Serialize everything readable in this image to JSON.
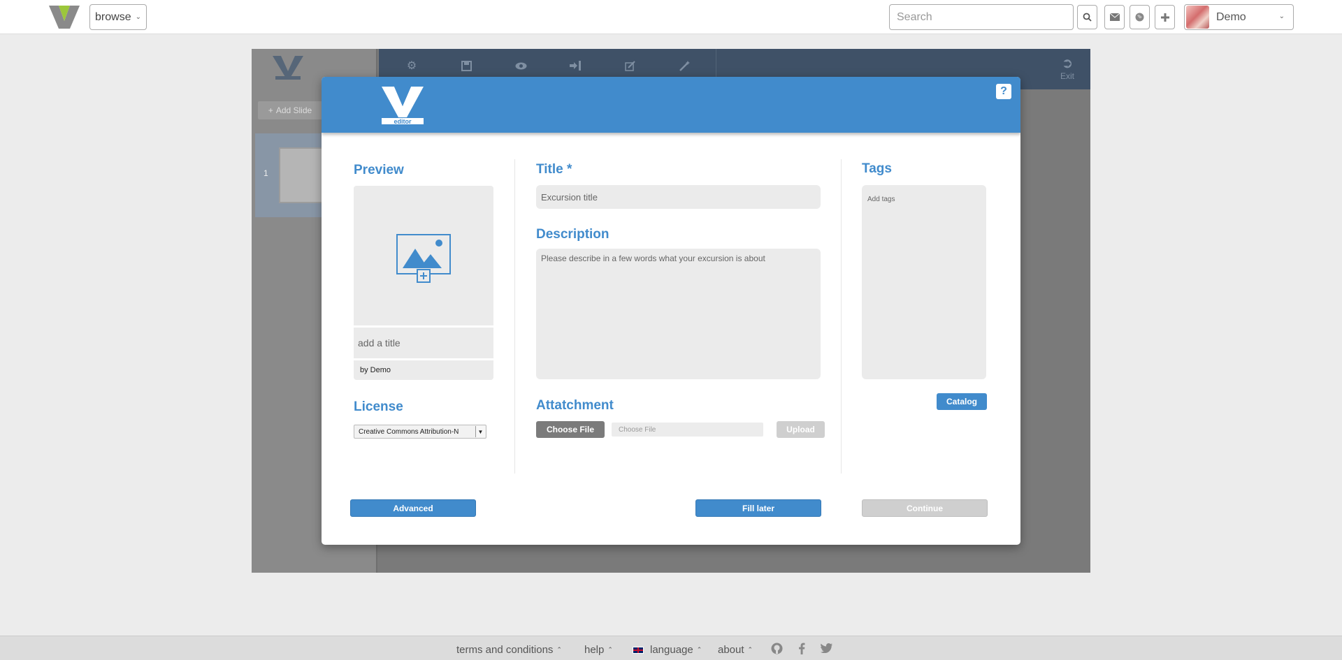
{
  "topbar": {
    "browse_label": "browse",
    "search_placeholder": "Search",
    "search_icon": "search-icon",
    "icons": [
      "search-icon",
      "envelope-icon",
      "globe-icon",
      "plus-icon"
    ],
    "user_name": "Demo"
  },
  "editor": {
    "add_slide_label": "Add Slide",
    "slide_number": "1",
    "exit_label": "Exit",
    "toolbar_icons": [
      "gear-icon",
      "save-icon",
      "eye-icon",
      "sign-in-icon",
      "edit-icon",
      "magic-wand-icon"
    ]
  },
  "modal": {
    "help_label": "?",
    "preview": {
      "heading": "Preview",
      "title_placeholder": "add a title",
      "author": "by Demo"
    },
    "license": {
      "heading": "License",
      "selected": "Creative Commons Attribution-N"
    },
    "title": {
      "heading": "Title *",
      "placeholder": "Excursion title"
    },
    "description": {
      "heading": "Description",
      "placeholder": "Please describe in a few words what your excursion is about"
    },
    "attachment": {
      "heading": "Attatchment",
      "choose_file_label": "Choose File",
      "file_name_placeholder": "Choose File",
      "upload_label": "Upload"
    },
    "tags": {
      "heading": "Tags",
      "placeholder": "Add tags",
      "catalog_label": "Catalog"
    },
    "buttons": {
      "advanced": "Advanced",
      "fill_later": "Fill later",
      "continue": "Continue"
    }
  },
  "footer": {
    "terms": "terms and conditions",
    "help": "help",
    "language": "language",
    "about": "about"
  },
  "colors": {
    "accent": "#418bcc",
    "toolbar": "#3f5167",
    "disabled": "#cfcfcf"
  }
}
